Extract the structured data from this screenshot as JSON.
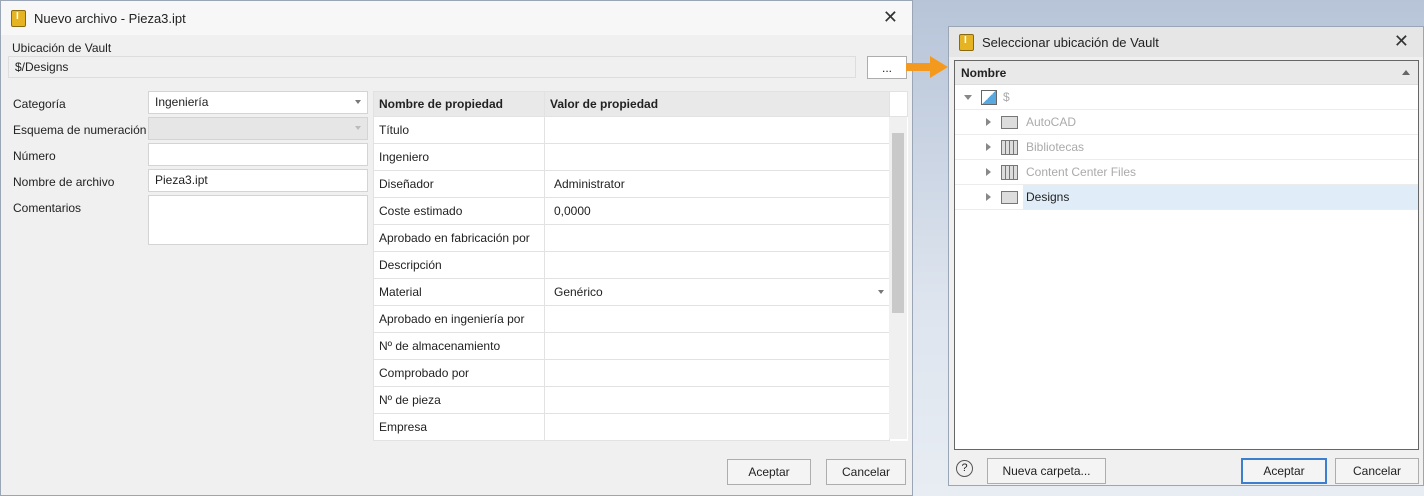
{
  "main_dialog": {
    "title": "Nuevo archivo - Pieza3.ipt",
    "vault_location_label": "Ubicación de Vault",
    "vault_location_value": "$/Designs",
    "browse_label": "...",
    "fields": {
      "category_label": "Categoría",
      "category_value": "Ingeniería",
      "numbering_label": "Esquema de numeración",
      "number_label": "Número",
      "filename_label": "Nombre de archivo",
      "filename_value": "Pieza3.ipt",
      "comments_label": "Comentarios"
    },
    "properties": {
      "col_name": "Nombre de propiedad",
      "col_value": "Valor de propiedad",
      "rows": [
        {
          "name": "Título",
          "value": ""
        },
        {
          "name": "Ingeniero",
          "value": ""
        },
        {
          "name": "Diseñador",
          "value": "Administrator"
        },
        {
          "name": "Coste estimado",
          "value": "0,0000"
        },
        {
          "name": "Aprobado en fabricación por",
          "value": ""
        },
        {
          "name": "Descripción",
          "value": ""
        },
        {
          "name": "Material",
          "value": "Genérico"
        },
        {
          "name": "Aprobado en ingeniería por",
          "value": ""
        },
        {
          "name": "Nº de almacenamiento",
          "value": ""
        },
        {
          "name": "Comprobado por",
          "value": ""
        },
        {
          "name": "Nº de pieza",
          "value": ""
        },
        {
          "name": "Empresa",
          "value": ""
        }
      ]
    },
    "ok": "Aceptar",
    "cancel": "Cancelar"
  },
  "vault_dialog": {
    "title": "Seleccionar ubicación de Vault",
    "column": "Nombre",
    "root": "$",
    "items": [
      "AutoCAD",
      "Bibliotecas",
      "Content Center Files",
      "Designs"
    ],
    "new_folder": "Nueva carpeta...",
    "help": "?",
    "ok": "Aceptar",
    "cancel": "Cancelar"
  },
  "colors": {
    "arrow": "#f39a1e",
    "selected": "#e0edf8",
    "accent": "#3c7fd1"
  }
}
